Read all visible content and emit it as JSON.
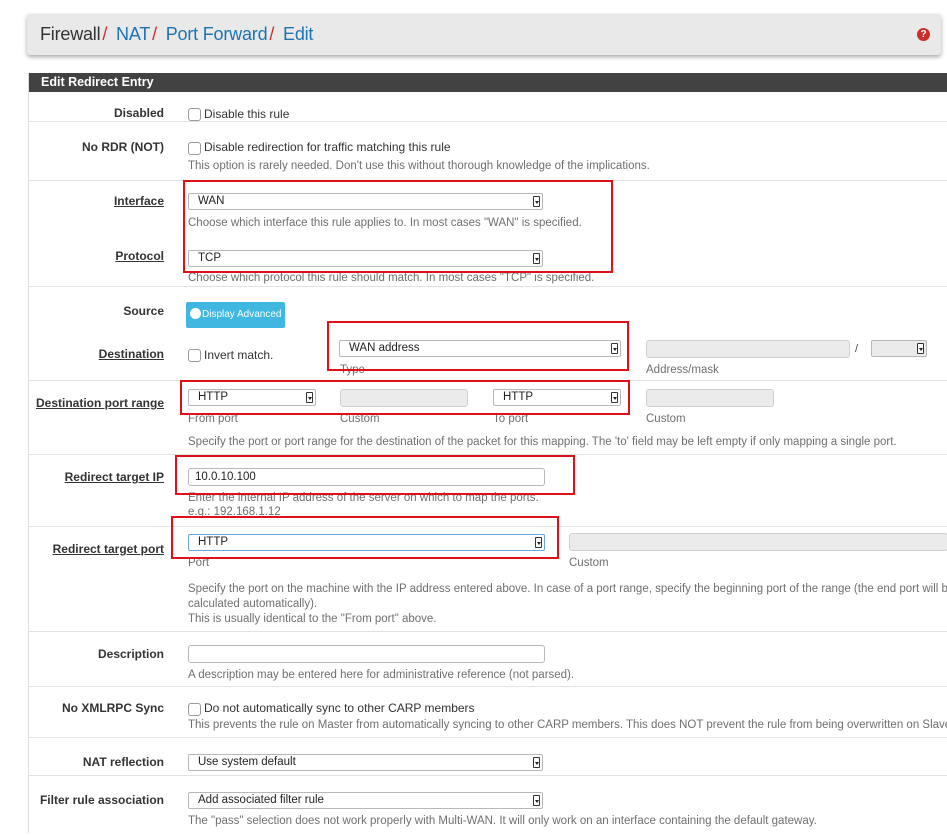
{
  "breadcrumb": {
    "part1": "Firewall",
    "part2": "NAT",
    "part3": "Port Forward",
    "part4": "Edit",
    "sep": "/"
  },
  "header": {
    "help_icon": "question-circle-icon"
  },
  "panel": {
    "title": "Edit Redirect Entry"
  },
  "disabled": {
    "label": "Disabled",
    "checkbox_text": "Disable this rule"
  },
  "nordr": {
    "label": "No RDR (NOT)",
    "checkbox_text": "Disable redirection for traffic matching this rule",
    "help": "This option is rarely needed. Don't use this without thorough knowledge of the implications."
  },
  "interface": {
    "label": "Interface",
    "value": "WAN",
    "help": "Choose which interface this rule applies to. In most cases \"WAN\" is specified."
  },
  "protocol": {
    "label": "Protocol",
    "value": "TCP",
    "help": "Choose which protocol this rule should match. In most cases \"TCP\" is specified."
  },
  "source": {
    "label": "Source",
    "button": "Display Advanced"
  },
  "destination": {
    "label": "Destination",
    "invert_text": "Invert match.",
    "type_value": "WAN address",
    "type_caption": "Type",
    "address_caption": "Address/mask",
    "slash": "/"
  },
  "dest_port": {
    "label": "Destination port range",
    "from_value": "HTTP",
    "from_caption": "From port",
    "custom1_caption": "Custom",
    "to_value": "HTTP",
    "to_caption": "To port",
    "custom2_caption": "Custom",
    "help": "Specify the port or port range for the destination of the packet for this mapping. The 'to' field may be left empty if only mapping a single port."
  },
  "target_ip": {
    "label": "Redirect target IP",
    "value": "10.0.10.100",
    "help1": "Enter the internal IP address of the server on which to map the ports.",
    "help2": "e.g.: 192.168.1.12"
  },
  "target_port": {
    "label": "Redirect target port",
    "value": "HTTP",
    "port_caption": "Port",
    "custom_caption": "Custom",
    "help1": "Specify the port on the machine with the IP address entered above. In case of a port range, specify the beginning port of the range (the end port will be",
    "help2": "calculated automatically).",
    "help3": "This is usually identical to the \"From port\" above."
  },
  "description": {
    "label": "Description",
    "value": "",
    "help": "A description may be entered here for administrative reference (not parsed)."
  },
  "xmlrpc": {
    "label": "No XMLRPC Sync",
    "checkbox_text": "Do not automatically sync to other CARP members",
    "help": "This prevents the rule on Master from automatically syncing to other CARP members. This does NOT prevent the rule from being overwritten on Slave."
  },
  "nat_reflection": {
    "label": "NAT reflection",
    "value": "Use system default"
  },
  "filter_assoc": {
    "label": "Filter rule association",
    "value": "Add associated filter rule",
    "help": "The \"pass\" selection does not work properly with Multi-WAN. It will only work on an interface containing the default gateway."
  },
  "colors": {
    "highlight": "#e0101a",
    "link": "#1d74b3",
    "panel_heading": "#424242",
    "button": "#3fb7e0"
  }
}
